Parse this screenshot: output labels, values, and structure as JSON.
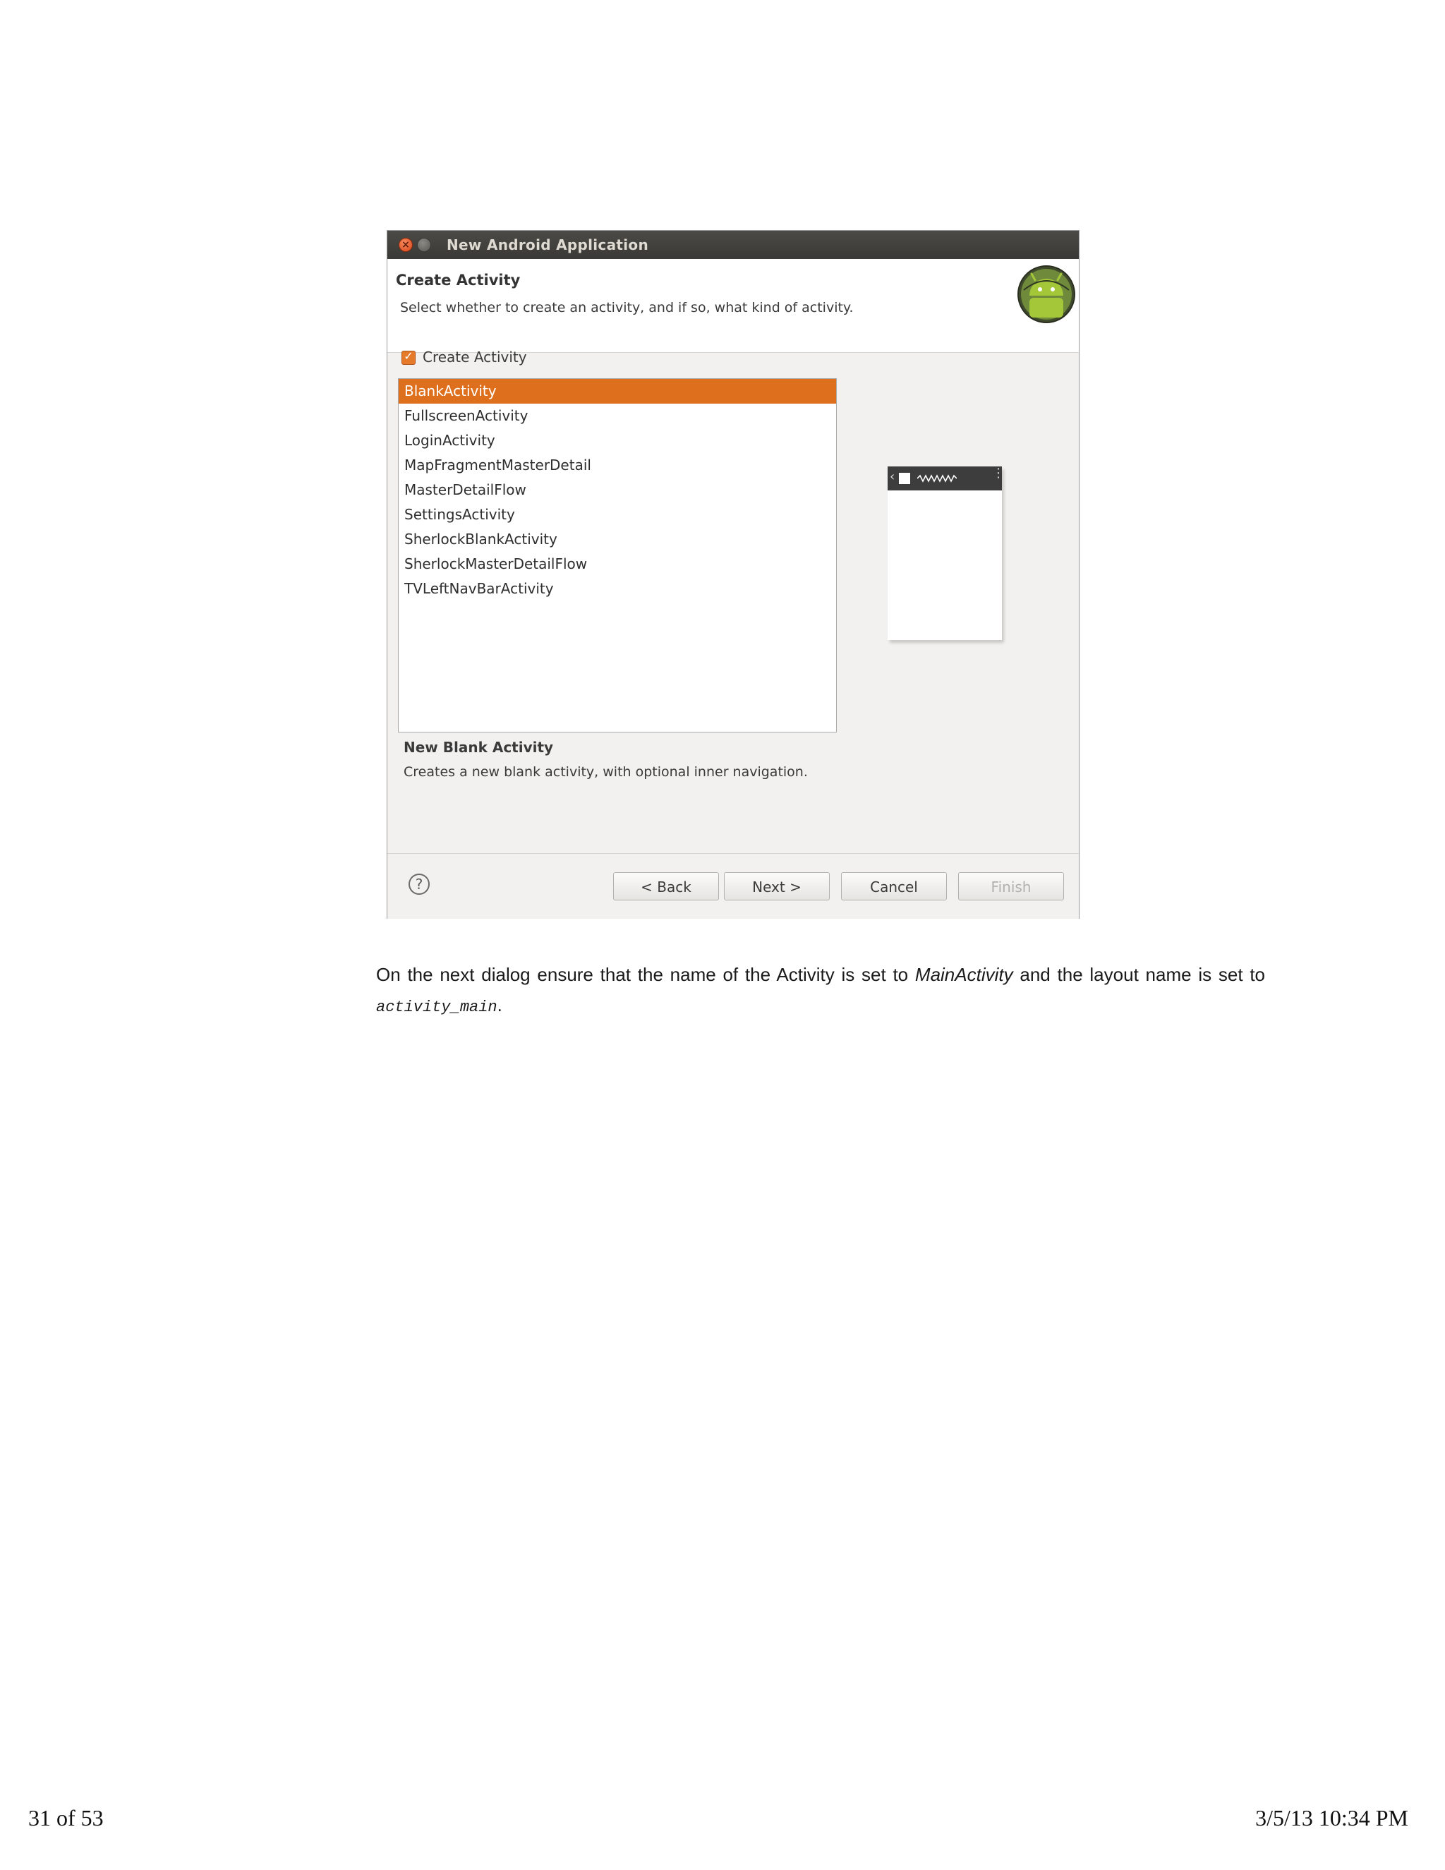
{
  "dialog": {
    "window_title": "New Android Application",
    "close_glyph": "×",
    "header_title": "Create Activity",
    "header_description": "Select whether to create an activity, and if so, what kind of activity.",
    "create_activity_checked": true,
    "create_activity_label": "Create Activity",
    "activities": [
      "BlankActivity",
      "FullscreenActivity",
      "LoginActivity",
      "MapFragmentMasterDetail",
      "MasterDetailFlow",
      "SettingsActivity",
      "SherlockBlankActivity",
      "SherlockMasterDetailFlow",
      "TVLeftNavBarActivity"
    ],
    "selected_index": 0,
    "preview": {
      "back_glyph": "‹",
      "menu_glyph": "⋮"
    },
    "selection_title": "New Blank Activity",
    "selection_description": "Creates a new blank activity, with optional inner navigation.",
    "help_glyph": "?",
    "buttons": {
      "back": "< Back",
      "next": "Next >",
      "cancel": "Cancel",
      "finish": "Finish"
    },
    "accent_color": "#dd6f1d",
    "icons": {
      "logo": "android-logo-icon",
      "help": "help-icon"
    }
  },
  "body": {
    "text_before": "On the next dialog ensure that the name of the Activity is set to ",
    "activity_name": "MainActivity",
    "text_middle": " and the layout name is set to ",
    "layout_name": "activity_main",
    "text_after": "."
  },
  "footer": {
    "page": "31 of 53",
    "timestamp": "3/5/13 10:34 PM"
  }
}
